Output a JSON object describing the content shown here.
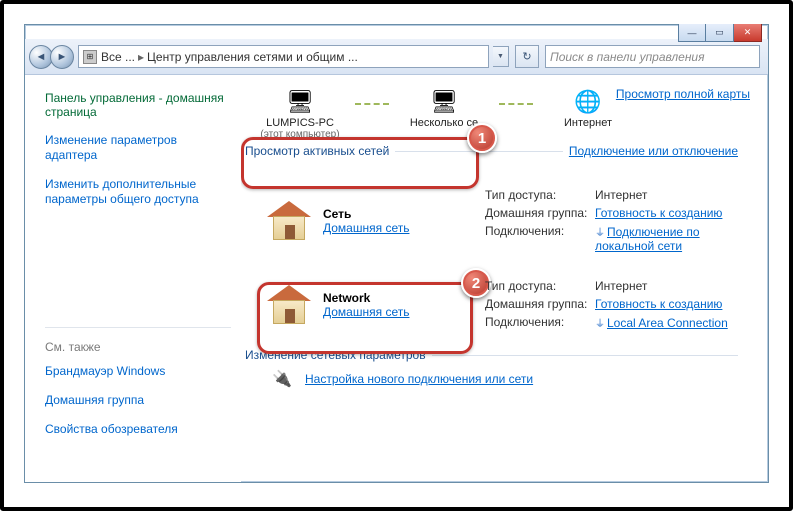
{
  "title_controls": {
    "min": "—",
    "max": "▭",
    "close": "✕"
  },
  "addressbar": {
    "root": "Все ...",
    "page": "Центр управления сетями и общим ...",
    "icon": "⊞"
  },
  "search": {
    "placeholder": "Поиск в панели управления"
  },
  "sidebar": {
    "home": "Панель управления - домашняя страница",
    "links": [
      "Изменение параметров адаптера",
      "Изменить дополнительные параметры общего доступа"
    ],
    "seealso_hdr": "См. также",
    "seealso": [
      "Брандмауэр Windows",
      "Домашняя группа",
      "Свойства обозревателя"
    ]
  },
  "map": {
    "items": [
      {
        "cap": "LUMPICS-PC",
        "sub": "(этот компьютер)",
        "ico": "🖥"
      },
      {
        "cap": "Несколько се",
        "sub": "",
        "ico": "🖥"
      },
      {
        "cap": "Интернет",
        "sub": "",
        "ico": "🌐"
      }
    ],
    "full": "Просмотр полной карты"
  },
  "active_hdr": "Просмотр активных сетей",
  "connect_toggle": "Подключение или отключение",
  "net1": {
    "name": "Сеть",
    "type": "Домашняя сеть",
    "access_l": "Тип доступа:",
    "access_v": "Интернет",
    "group_l": "Домашняя группа:",
    "group_v": "Готовность к созданию",
    "conn_l": "Подключения:",
    "conn_v": "Подключение по локальной сети"
  },
  "net2": {
    "name": "Network",
    "type": "Домашняя сеть",
    "access_l": "Тип доступа:",
    "access_v": "Интернет",
    "group_l": "Домашняя группа:",
    "group_v": "Готовность к созданию",
    "conn_l": "Подключения:",
    "conn_v": "Local Area Connection"
  },
  "badges": {
    "b1": "1",
    "b2": "2"
  },
  "change_hdr": "Изменение сетевых параметров",
  "wizard": "Настройка нового подключения или сети"
}
